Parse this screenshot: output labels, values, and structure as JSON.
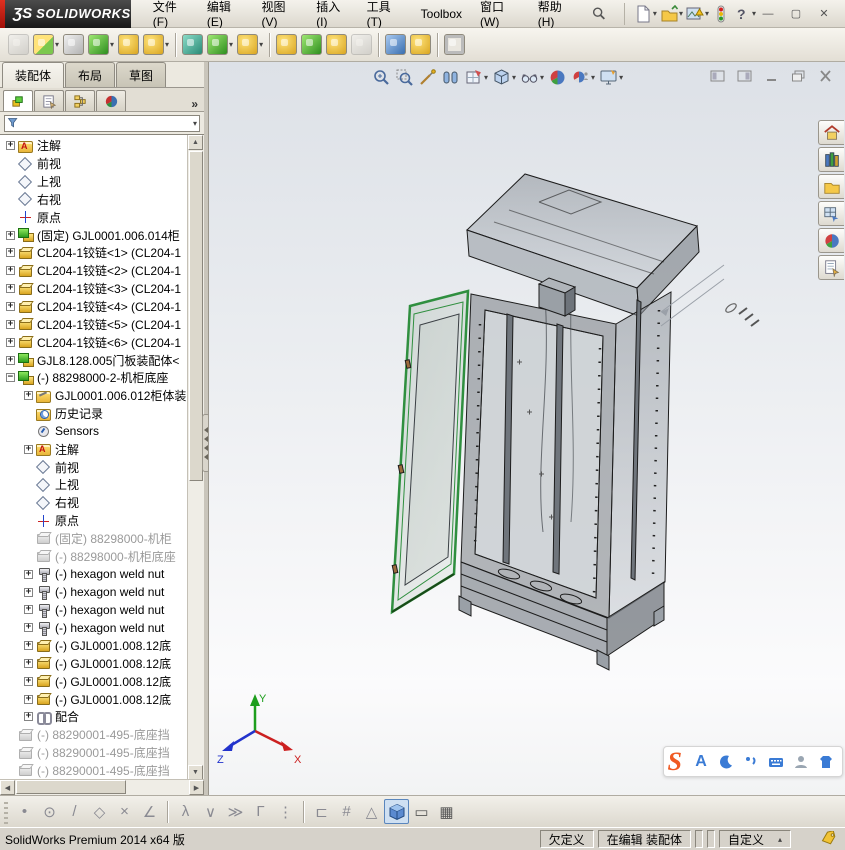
{
  "titlebar": {
    "brand_mark": "ƷS",
    "brand_word": "SOLIDWORKS",
    "menus": [
      {
        "key": "file",
        "label": "文件(F)"
      },
      {
        "key": "edit",
        "label": "编辑(E)"
      },
      {
        "key": "view",
        "label": "视图(V)"
      },
      {
        "key": "insert",
        "label": "插入(I)"
      },
      {
        "key": "tools",
        "label": "工具(T)"
      },
      {
        "key": "toolbox",
        "label": "Toolbox"
      },
      {
        "key": "window",
        "label": "窗口(W)"
      },
      {
        "key": "help",
        "label": "帮助(H)"
      }
    ],
    "quick_access": [
      {
        "name": "new-document",
        "dropdown": true
      },
      {
        "name": "open-document",
        "dropdown": true
      },
      {
        "name": "publish-edrawings",
        "dropdown": true
      },
      {
        "name": "options-traffic-light",
        "dropdown": false
      },
      {
        "name": "help-question",
        "dropdown": true
      }
    ],
    "window_buttons": [
      {
        "name": "minimize",
        "glyph": "—"
      },
      {
        "name": "maximize",
        "glyph": "▢"
      },
      {
        "name": "close",
        "glyph": "✕"
      }
    ]
  },
  "main_toolbar": {
    "icons": [
      {
        "name": "insert-components",
        "variant": "v-gray",
        "disabled": true
      },
      {
        "name": "open-part",
        "variant": "v-mix",
        "dropdown": true
      },
      {
        "name": "attachment-clip",
        "variant": "v-gray"
      },
      {
        "name": "mate",
        "variant": "v-green",
        "dropdown": true
      },
      {
        "name": "smart-fasteners",
        "variant": "v-gold"
      },
      {
        "name": "rotate-component",
        "variant": "v-gold",
        "dropdown": true,
        "sep_after": true
      },
      {
        "name": "show-hidden-components",
        "variant": "v-teal"
      },
      {
        "name": "assembly-features",
        "variant": "v-green",
        "dropdown": true
      },
      {
        "name": "reference-geometry",
        "variant": "v-gold",
        "dropdown": true,
        "sep_after": true
      },
      {
        "name": "new-motion-study",
        "variant": "v-gold"
      },
      {
        "name": "exploded-view",
        "variant": "v-green"
      },
      {
        "name": "instant-3d",
        "variant": "v-gold"
      },
      {
        "name": "sketch-tool-disabled",
        "variant": "v-gray",
        "disabled": true,
        "sep_after": true
      },
      {
        "name": "measure",
        "variant": "v-blue"
      },
      {
        "name": "simulation-advisor",
        "variant": "v-gold",
        "sep_after": true
      },
      {
        "name": "preview-window",
        "variant": "v-frame"
      }
    ]
  },
  "command_tabs": {
    "tabs": [
      {
        "key": "assembly",
        "label": "装配体",
        "active": true
      },
      {
        "key": "layout",
        "label": "布局",
        "active": false
      },
      {
        "key": "sketch",
        "label": "草图",
        "active": false
      }
    ]
  },
  "feature_manager": {
    "tabs": [
      {
        "name": "featuremanager-tree",
        "active": true
      },
      {
        "name": "propertymanager",
        "active": false
      },
      {
        "name": "configurationmanager",
        "active": false
      },
      {
        "name": "displaymanager",
        "active": false
      }
    ],
    "overflow_chevron": "»"
  },
  "tree": {
    "items": [
      {
        "label": "注解",
        "level": 1,
        "expand": "plus",
        "icon": "folder-a"
      },
      {
        "label": "前视",
        "level": 1,
        "icon": "plane"
      },
      {
        "label": "上视",
        "level": 1,
        "icon": "plane"
      },
      {
        "label": "右视",
        "level": 1,
        "icon": "plane"
      },
      {
        "label": "原点",
        "level": 1,
        "icon": "origin"
      },
      {
        "label": "(固定) GJL0001.006.014柜",
        "level": 1,
        "expand": "plus",
        "icon": "asm"
      },
      {
        "label": "CL204-1铰链<1> (CL204-1",
        "level": 1,
        "expand": "plus",
        "icon": "part"
      },
      {
        "label": "CL204-1铰链<2> (CL204-1",
        "level": 1,
        "expand": "plus",
        "icon": "part"
      },
      {
        "label": "CL204-1铰链<3> (CL204-1",
        "level": 1,
        "expand": "plus",
        "icon": "part"
      },
      {
        "label": "CL204-1铰链<4> (CL204-1",
        "level": 1,
        "expand": "plus",
        "icon": "part"
      },
      {
        "label": "CL204-1铰链<5> (CL204-1",
        "level": 1,
        "expand": "plus",
        "icon": "part"
      },
      {
        "label": "CL204-1铰链<6> (CL204-1",
        "level": 1,
        "expand": "plus",
        "icon": "part"
      },
      {
        "label": "GJL8.128.005门板装配体<",
        "level": 1,
        "expand": "plus",
        "icon": "asm"
      },
      {
        "label": "(-) 88298000-2-机柜底座",
        "level": 1,
        "expand": "minus",
        "icon": "asm"
      },
      {
        "label": "GJL0001.006.012柜体装",
        "level": 2,
        "expand": "plus",
        "icon": "binder"
      },
      {
        "label": "历史记录",
        "level": 2,
        "icon": "history"
      },
      {
        "label": "Sensors",
        "level": 2,
        "icon": "sensors"
      },
      {
        "label": "注解",
        "level": 2,
        "expand": "plus",
        "icon": "folder-a"
      },
      {
        "label": "前视",
        "level": 2,
        "icon": "plane"
      },
      {
        "label": "上视",
        "level": 2,
        "icon": "plane"
      },
      {
        "label": "右视",
        "level": 2,
        "icon": "plane"
      },
      {
        "label": "原点",
        "level": 2,
        "icon": "origin"
      },
      {
        "label": "(固定) 88298000-机柜",
        "level": 2,
        "icon": "part",
        "gray": true
      },
      {
        "label": "(-) 88298000-机柜底座",
        "level": 2,
        "icon": "part",
        "gray": true
      },
      {
        "label": "(-) hexagon weld nut",
        "level": 2,
        "expand": "plus",
        "icon": "bolt"
      },
      {
        "label": "(-) hexagon weld nut",
        "level": 2,
        "expand": "plus",
        "icon": "bolt"
      },
      {
        "label": "(-) hexagon weld nut",
        "level": 2,
        "expand": "plus",
        "icon": "bolt"
      },
      {
        "label": "(-) hexagon weld nut",
        "level": 2,
        "expand": "plus",
        "icon": "bolt"
      },
      {
        "label": "(-) GJL0001.008.12底",
        "level": 2,
        "expand": "plus",
        "icon": "part"
      },
      {
        "label": "(-) GJL0001.008.12底",
        "level": 2,
        "expand": "plus",
        "icon": "part"
      },
      {
        "label": "(-) GJL0001.008.12底",
        "level": 2,
        "expand": "plus",
        "icon": "part"
      },
      {
        "label": "(-) GJL0001.008.12底",
        "level": 2,
        "expand": "plus",
        "icon": "part"
      },
      {
        "label": "配合",
        "level": 2,
        "expand": "plus",
        "icon": "mates"
      },
      {
        "label": "(-) 88290001-495-底座挡",
        "level": 1,
        "icon": "part",
        "gray": true
      },
      {
        "label": "(-) 88290001-495-底座挡",
        "level": 1,
        "icon": "part",
        "gray": true
      },
      {
        "label": "(-) 88290001-495-底座挡",
        "level": 1,
        "icon": "part",
        "gray": true
      }
    ]
  },
  "headsup_toolbar": {
    "icons": [
      {
        "name": "zoom-to-fit",
        "dropdown": false
      },
      {
        "name": "zoom-to-area",
        "dropdown": false
      },
      {
        "name": "selection-wand",
        "dropdown": false
      },
      {
        "name": "section-view",
        "dropdown": false
      },
      {
        "name": "view-orientation",
        "dropdown": true
      },
      {
        "name": "display-style",
        "dropdown": true
      },
      {
        "name": "hide-show-items",
        "dropdown": true
      },
      {
        "name": "edit-appearance",
        "dropdown": false
      },
      {
        "name": "apply-scene",
        "dropdown": true
      },
      {
        "name": "view-settings",
        "dropdown": true
      }
    ]
  },
  "doc_window_buttons": [
    {
      "name": "doc-pane-left"
    },
    {
      "name": "doc-pane-right"
    },
    {
      "name": "doc-minimize"
    },
    {
      "name": "doc-restore"
    },
    {
      "name": "doc-close"
    }
  ],
  "task_pane": {
    "icons": [
      "solidworks-resources",
      "design-library",
      "file-explorer",
      "view-palette",
      "appearances",
      "custom-properties"
    ]
  },
  "triad": {
    "x_label": "X",
    "y_label": "Y",
    "z_label": "Z",
    "x_color": "#cc2020",
    "y_color": "#1d9e1d",
    "z_color": "#2233cc"
  },
  "ime": {
    "logo": "S",
    "mode_letter": "A",
    "icons": [
      "english-mode",
      "night-mode",
      "punctuation",
      "virtual-keyboard",
      "account",
      "skin"
    ]
  },
  "sketch_toolbar": {
    "icons": [
      {
        "name": "sketch-point",
        "glyph": "•"
      },
      {
        "name": "sketch-circle",
        "glyph": "⊙"
      },
      {
        "name": "sketch-line",
        "glyph": "/"
      },
      {
        "name": "sketch-polygon",
        "glyph": "◇"
      },
      {
        "name": "trim-entities",
        "glyph": "×"
      },
      {
        "name": "sketch-angle",
        "glyph": "∠"
      },
      {
        "sep": true
      },
      {
        "name": "tangent-relation",
        "glyph": "λ"
      },
      {
        "name": "coincident-relation",
        "glyph": "∨"
      },
      {
        "name": "parallel-relation",
        "glyph": "≫"
      },
      {
        "name": "perpendicular-relation",
        "glyph": "Γ"
      },
      {
        "name": "trace-points",
        "glyph": "⋮"
      },
      {
        "sep": true
      },
      {
        "name": "smart-dimension",
        "glyph": "⊏"
      },
      {
        "name": "grid-snap",
        "glyph": "#"
      },
      {
        "name": "angle-snap",
        "glyph": "△"
      },
      {
        "name": "shaded-view",
        "glyph": "",
        "active": true,
        "cube": true
      },
      {
        "name": "single-viewport",
        "glyph": "▭",
        "dark": true
      },
      {
        "name": "four-viewport",
        "glyph": "▦",
        "dark": true
      }
    ]
  },
  "status_bar": {
    "app_version": "SolidWorks Premium 2014 x64 版",
    "define_state": "欠定义",
    "edit_state": "在编辑 装配体",
    "custom_label": "自定义"
  },
  "colors": {
    "accent_red": "#cc1111",
    "door_green": "#2f8f3f",
    "brand_dark": "#1a1a1a",
    "viewport_top": "#dde1e7",
    "viewport_bottom": "#f2f3f4"
  }
}
